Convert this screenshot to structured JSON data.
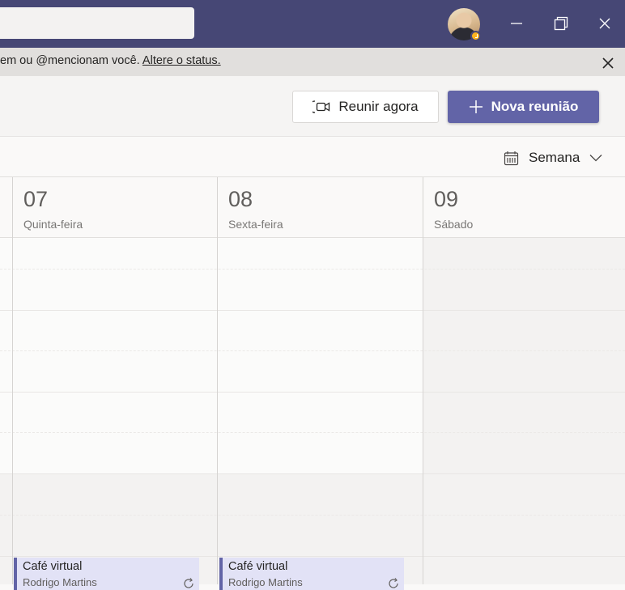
{
  "notice": {
    "text": "em ou @mencionam você.",
    "link": "Altere o status."
  },
  "actions": {
    "meet_now_label": "Reunir agora",
    "new_meeting_label": "Nova reunião"
  },
  "view": {
    "label": "Semana"
  },
  "days": [
    {
      "number": "07",
      "name": "Quinta-feira"
    },
    {
      "number": "08",
      "name": "Sexta-feira"
    },
    {
      "number": "09",
      "name": "Sábado"
    }
  ],
  "events": [
    {
      "title": "Café virtual",
      "subtitle": "Rodrigo Martins"
    },
    {
      "title": "Café virtual",
      "subtitle": "Rodrigo Martins"
    }
  ],
  "colors": {
    "titlebar": "#464775",
    "accent": "#6264a7",
    "event_bg": "#e2e2f6",
    "away_status": "#fcb31e"
  },
  "icons": {
    "avatar_status": "clock-icon",
    "meet_now": "video-camera-icon",
    "new_meeting": "plus-icon",
    "view": "calendar-icon",
    "view_dropdown": "chevron-down-icon",
    "minimize": "minimize-icon",
    "restore": "restore-icon",
    "close": "close-icon",
    "recurring": "repeat-icon"
  }
}
